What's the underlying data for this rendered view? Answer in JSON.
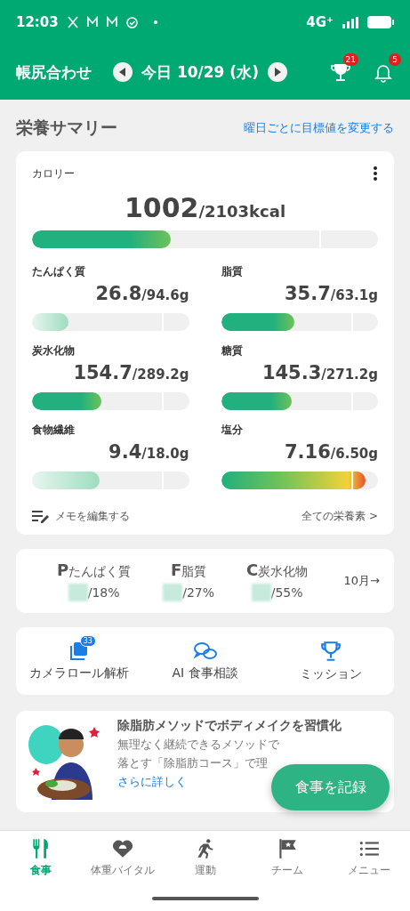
{
  "status_bar": {
    "time": "12:03",
    "network": "4G⁺"
  },
  "header": {
    "title": "帳尻合わせ",
    "date": "今日 10/29 (水)",
    "trophy_badge": "21",
    "bell_badge": "5"
  },
  "summary": {
    "title": "栄養サマリー",
    "link": "曜日ごとに目標値を変更する"
  },
  "calorie": {
    "label": "カロリー",
    "value": "1002",
    "target": "/2103",
    "unit": "kcal",
    "level": 0.4
  },
  "nutrients": [
    {
      "label": "たんぱく質",
      "value": "26.8",
      "target": "/94.6g",
      "level": 0.23,
      "kind": "low"
    },
    {
      "label": "脂質",
      "value": "35.7",
      "target": "/63.1g",
      "level": 0.47,
      "kind": "ok"
    },
    {
      "label": "炭水化物",
      "value": "154.7",
      "target": "/289.2g",
      "level": 0.44,
      "kind": "ok"
    },
    {
      "label": "糖質",
      "value": "145.3",
      "target": "/271.2g",
      "level": 0.45,
      "kind": "ok"
    },
    {
      "label": "食物繊維",
      "value": "9.4",
      "target": "/18.0g",
      "level": 0.43,
      "kind": "low"
    },
    {
      "label": "塩分",
      "value": "7.16",
      "target": "/6.50g",
      "level": 0.92,
      "kind": "over"
    }
  ],
  "card_footer": {
    "memo": "メモを編集する",
    "all": "全ての栄養素 >"
  },
  "pfc": {
    "items": [
      {
        "letter": "P",
        "label": "たんぱく質",
        "ratio": "/18%"
      },
      {
        "letter": "F",
        "label": "脂質",
        "ratio": "/27%"
      },
      {
        "letter": "C",
        "label": "炭水化物",
        "ratio": "/55%"
      }
    ],
    "month": "10月→"
  },
  "shortcuts": [
    {
      "kind": "camera",
      "label": "カメラロール解析",
      "badge": "33"
    },
    {
      "kind": "chat",
      "label": "AI 食事相談"
    },
    {
      "kind": "trophy",
      "label": "ミッション"
    }
  ],
  "promo": {
    "kind": "picture",
    "title": "除脂肪メソッドでボディメイクを習慣化",
    "line1": "無理なく継続できるメソッドで",
    "line2": "落とす「除脂肪コース」で理",
    "link": "さらに詳しく"
  },
  "fab": "食事を記録",
  "nav": [
    {
      "kind": "meal",
      "label": "食事",
      "selected": true
    },
    {
      "kind": "weight",
      "label": "体重バイタル",
      "selected": false
    },
    {
      "kind": "run",
      "label": "運動",
      "selected": false
    },
    {
      "kind": "team",
      "label": "チーム",
      "selected": false
    },
    {
      "kind": "menu",
      "label": "メニュー",
      "selected": false
    }
  ]
}
